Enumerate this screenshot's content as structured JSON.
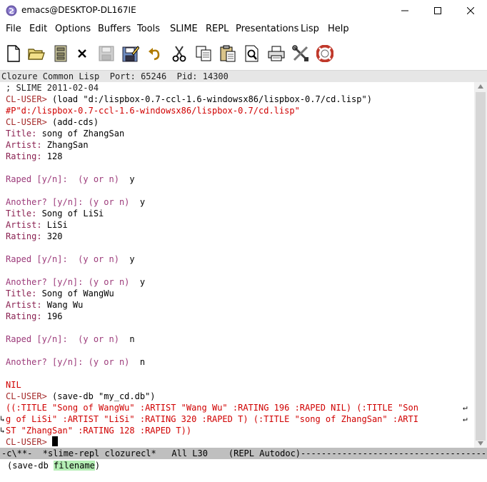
{
  "window": {
    "title": "emacs@DESKTOP-DL167IE"
  },
  "menu": [
    "File",
    "Edit",
    "Options",
    "Buffers",
    "Tools",
    "SLIME",
    "REPL",
    "Presentations",
    "Lisp",
    "Help"
  ],
  "toolbar_icons": [
    "new-file-icon",
    "open-folder-icon",
    "open-dired-icon",
    "close-icon",
    "save-icon",
    "save-as-icon",
    "undo-icon",
    "cut-icon",
    "copy-icon",
    "paste-icon",
    "search-icon",
    "print-icon",
    "preferences-icon",
    "help-icon"
  ],
  "header_line": "Clozure Common Lisp  Port: 65246  Pid: 14300",
  "repl": {
    "l1": "; SLIME 2011-02-04",
    "p2": "CL-USER> ",
    "i2": "(load \"d:/lispbox-0.7-ccl-1.6-windowsx86/lispbox-0.7/cd.lisp\")",
    "r3": "#P\"d:/lispbox-0.7-ccl-1.6-windowsx86/lispbox-0.7/cd.lisp\"",
    "p4": "CL-USER> ",
    "i4": "(add-cds)",
    "q5": "Title: ",
    "a5": "song of ZhangSan",
    "q6": "Artist: ",
    "a6": "ZhangSan",
    "q7": "Rating: ",
    "a7": "128",
    "q9": "Raped [y/n]:  (y or n)  ",
    "a9": "y",
    "q11": "Another? [y/n]: (y or n)  ",
    "a11": "y",
    "q12": "Title: ",
    "a12": "Song of LiSi",
    "q13": "Artist: ",
    "a13": "LiSi",
    "q14": "Rating: ",
    "a14": "320",
    "q16": "Raped [y/n]:  (y or n)  ",
    "a16": "y",
    "q18": "Another? [y/n]: (y or n)  ",
    "a18": "y",
    "q19": "Title: ",
    "a19": "Song of WangWu",
    "q20": "Artist: ",
    "a20": "Wang Wu",
    "q21": "Rating: ",
    "a21": "196",
    "q23": "Raped [y/n]:  (y or n)  ",
    "a23": "n",
    "q25": "Another? [y/n]: (y or n)  ",
    "a25": "n",
    "r27": "NIL",
    "p28": "CL-USER> ",
    "i28": "(save-db \"my_cd.db\")",
    "r29": "((:TITLE \"Song of WangWu\" :ARTIST \"Wang Wu\" :RATING 196 :RAPED NIL) (:TITLE \"Son",
    "r30": "g of LiSi\" :ARTIST \"LiSi\" :RATING 320 :RAPED T) (:TITLE \"song of ZhangSan\" :ARTI",
    "r31": "ST \"ZhangSan\" :RATING 128 :RAPED T))",
    "p32": "CL-USER> "
  },
  "modeline": "-c\\**-  *slime-repl clozurecl*   All L30    (REPL Autodoc)------------------------------------",
  "minibuffer": {
    "before": "(save-db ",
    "highlight": "filename",
    "after": ")"
  },
  "colors": {
    "prompt": "#a52a2a",
    "result": "#d00000",
    "query": "#9c3a7a",
    "highlight": "#b4eeb4",
    "modeline": "#bfbfbf"
  }
}
